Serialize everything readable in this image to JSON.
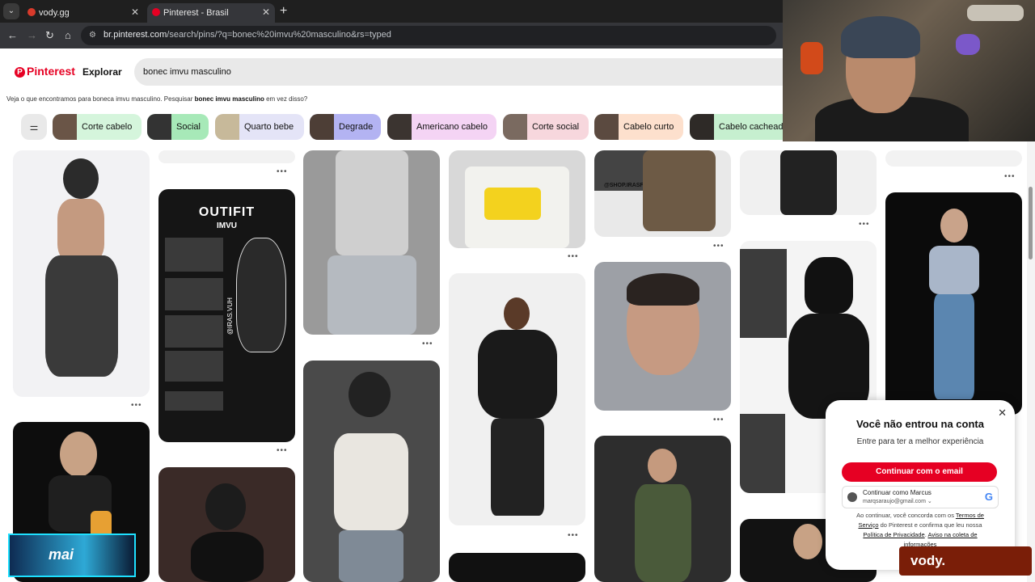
{
  "browser": {
    "tabs": [
      {
        "title": "vody.gg",
        "active": false
      },
      {
        "title": "Pinterest - Brasil",
        "active": true
      }
    ],
    "new_tab": "+",
    "url_host": "br.pinterest.com",
    "url_path": "/search/pins/?q=bonec%20imvu%20masculino&rs=typed"
  },
  "pinterest": {
    "logo_text": "Pinterest",
    "nav_explore": "Explorar",
    "search_value": "bonec imvu masculino",
    "hint_prefix": "Veja o que encontramos para boneca imvu masculino. Pesquisar",
    "hint_query": "bonec imvu masculino",
    "hint_suffix": "em vez disso?",
    "chips": [
      {
        "label": "Corte cabelo",
        "color": "#d5f5dc"
      },
      {
        "label": "Social",
        "color": "#a7e9b8"
      },
      {
        "label": "Quarto bebe",
        "color": "#e4e4f7"
      },
      {
        "label": "Degrade",
        "color": "#b3b3f2"
      },
      {
        "label": "Americano cabelo",
        "color": "#f4d4f4"
      },
      {
        "label": "Corte social",
        "color": "#f7d7dd"
      },
      {
        "label": "Cabelo curto",
        "color": "#fde0cd"
      },
      {
        "label": "Cabelo cacheado",
        "color": "#c6efcf"
      }
    ],
    "pin_text": {
      "outfit_title": "OUTIFIT",
      "outfit_sub": "IMVU",
      "outfit_handle": "@IRAS.VUH",
      "shop_handle": "@SHOP.IRASFITS"
    },
    "more_icon": "•••"
  },
  "login_modal": {
    "title": "Você não entrou na conta",
    "subtitle": "Entre para ter a melhor experiência",
    "email_button": "Continuar com o email",
    "google_name": "Continuar como Marcus",
    "google_email": "marqsaraujo@gmail.com",
    "google_mark": "G",
    "legal_1": "Ao continuar, você concorda com os",
    "legal_terms": "Termos de Serviço",
    "legal_2": "do Pinterest e confirma que leu nossa",
    "legal_privacy": "Política de Privacidade",
    "legal_3": ".",
    "legal_notice": "Aviso na coleta de informações"
  },
  "overlay": {
    "stream_badge": "mai",
    "brand": "vody."
  },
  "colors": {
    "pinterest_red": "#e60023",
    "chrome_dark": "#1f1f1f"
  }
}
